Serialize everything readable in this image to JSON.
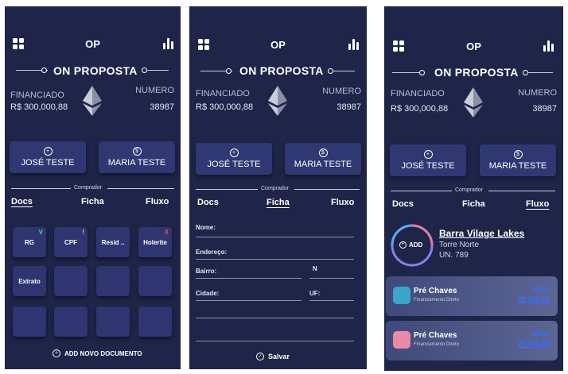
{
  "header": {
    "title": "OP",
    "proposal_title": "ON PROPOSTA"
  },
  "summary": {
    "financed_label": "FINANCIADO",
    "financed_value": "R$ 300,000,88",
    "number_label": "NUMERO",
    "number_value": "38987"
  },
  "persons": [
    {
      "name": "JOSÉ TESTE"
    },
    {
      "name": "MARIA TESTE"
    }
  ],
  "comprador_label": "Comprador",
  "tabs": [
    {
      "label": "Docs"
    },
    {
      "label": "Ficha"
    },
    {
      "label": "Fluxo"
    }
  ],
  "docs": {
    "tiles": [
      {
        "label": "RG",
        "mark": "V",
        "mark_color": "#3ddc84"
      },
      {
        "label": "CPF",
        "mark": "!",
        "mark_color": "#f4d35e"
      },
      {
        "label": "Resid ..",
        "mark": "",
        "mark_color": ""
      },
      {
        "label": "Holerite",
        "mark": "X",
        "mark_color": "#e05a5a"
      },
      {
        "label": "Extrato",
        "mark": "",
        "mark_color": ""
      }
    ],
    "add_label": "ADD NOVO DOCUMENTO"
  },
  "ficha": {
    "fields": {
      "nome": "Nome:",
      "endereco": "Endereço:",
      "bairro": "Bairro:",
      "numero": "N",
      "cidade": "Cidade:",
      "uf": "UF:"
    },
    "save_label": "Salvar"
  },
  "fluxo": {
    "add_label": "ADD",
    "property": {
      "name": "Barra Vilage Lakes",
      "tower": "Torre Norte",
      "unit": "UN. 789"
    },
    "cards": [
      {
        "title": "Pré Chaves",
        "subtitle": "Financiamento Direto",
        "value_label": "Valor",
        "value": "20.000,00",
        "icon_color": "#3aa6c9"
      },
      {
        "title": "Pré Chaves",
        "subtitle": "Financiamento Direto",
        "value_label": "Valor",
        "value": "20.000,00",
        "icon_color": "#e98aa8"
      }
    ]
  },
  "colors": {
    "panel_bg": "#1e2548",
    "tile_bg": "#2e3570",
    "accent_link": "#3b6dff"
  }
}
